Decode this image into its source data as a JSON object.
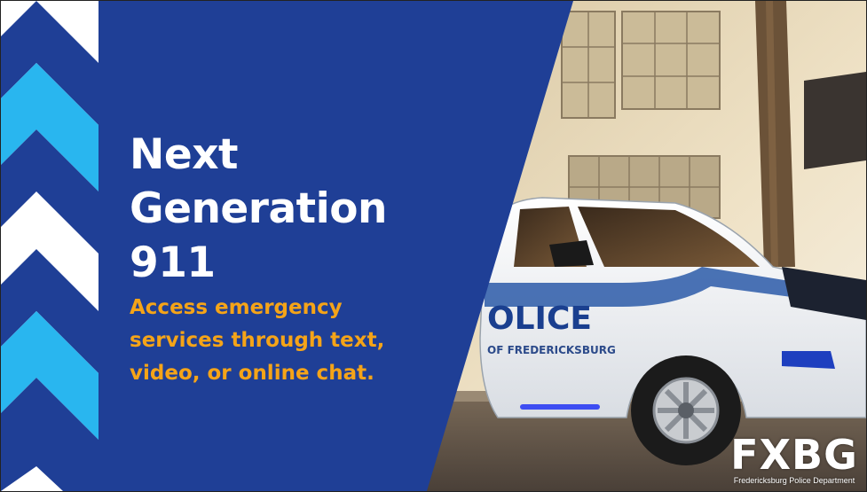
{
  "headline": {
    "line1": "Next",
    "line2": "Generation",
    "line3": "911"
  },
  "tagline": {
    "line1": "Access emergency",
    "line2": "services through text,",
    "line3": "video, or online chat."
  },
  "vehicle": {
    "door_text": "OLICE",
    "door_subtext": "OF FREDERICKSBURG"
  },
  "logo": {
    "mark": "FXBG",
    "subtitle": "Fredericksburg Police Department"
  },
  "colors": {
    "panel_blue": "#1f3f96",
    "chevron_dark": "#1f3f96",
    "chevron_light": "#29b6ef",
    "tagline_orange": "#f5a418",
    "text_white": "#ffffff"
  }
}
